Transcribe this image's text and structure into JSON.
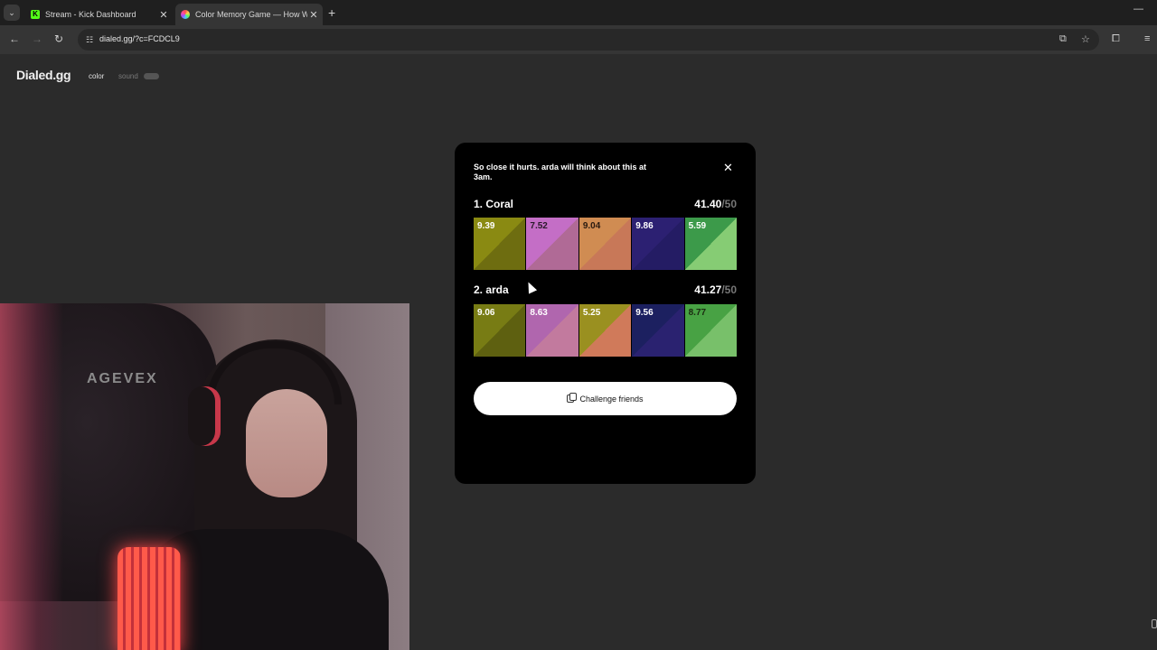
{
  "browser": {
    "tabs": [
      {
        "title": "Stream - Kick Dashboard",
        "icon": "kick-icon",
        "active": false
      },
      {
        "title": "Color Memory Game — How W",
        "icon": "color-wheel-icon",
        "active": true
      }
    ],
    "url": "dialed.gg/?c=FCDCL9"
  },
  "site": {
    "logo": "Dialed.gg",
    "nav": {
      "color": "color",
      "sound": "sound"
    }
  },
  "result": {
    "message": "So close it hurts. arda will think about this at 3am.",
    "players": [
      {
        "label": "1. Coral",
        "score": "41.40",
        "max": "/50",
        "swatches": [
          {
            "score": "9.39",
            "target": "#8a8a12",
            "guess": "#6e6d10",
            "text": "#ffffff"
          },
          {
            "score": "7.52",
            "target": "#c46ec6",
            "guess": "#b06a96",
            "text": "#2a1a2a"
          },
          {
            "score": "9.04",
            "target": "#d08c52",
            "guess": "#c87858",
            "text": "#2a1a10"
          },
          {
            "score": "9.86",
            "target": "#2c2072",
            "guess": "#241c64",
            "text": "#ffffff"
          },
          {
            "score": "5.59",
            "target": "#3c9a4a",
            "guess": "#86cc74",
            "text": "#ffffff"
          }
        ]
      },
      {
        "label": "2. arda",
        "score": "41.27",
        "max": "/50",
        "swatches": [
          {
            "score": "9.06",
            "target": "#787c14",
            "guess": "#5e6010",
            "text": "#ffffff"
          },
          {
            "score": "8.63",
            "target": "#b066ae",
            "guess": "#c27a9e",
            "text": "#ffffff"
          },
          {
            "score": "5.25",
            "target": "#9a9020",
            "guess": "#d07a5a",
            "text": "#ffffff"
          },
          {
            "score": "9.56",
            "target": "#1c2060",
            "guess": "#2a2270",
            "text": "#ffffff"
          },
          {
            "score": "8.77",
            "target": "#48a244",
            "guess": "#78c06a",
            "text": "#1a2a10"
          }
        ]
      }
    ],
    "challenge_label": "Challenge friends"
  },
  "webcam": {
    "chair_brand": "AGEVEX"
  }
}
